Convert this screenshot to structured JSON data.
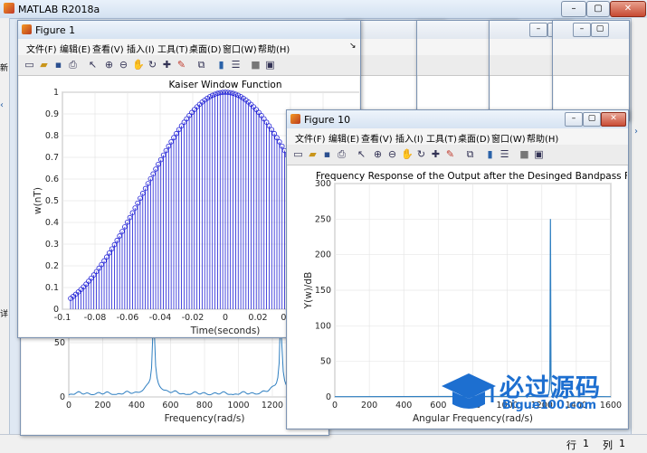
{
  "main": {
    "title": "MATLAB R2018a",
    "left_labels": {
      "new": "新",
      "detail": "详"
    },
    "status": {
      "row_label": "行",
      "row_value": "1",
      "col_label": "列",
      "col_value": "1"
    }
  },
  "figure_menu": [
    "文件(F)",
    "编辑(E)",
    "查看(V)",
    "插入(I)",
    "工具(T)",
    "桌面(D)",
    "窗口(W)",
    "帮助(H)"
  ],
  "figure1": {
    "title": "Figure 1",
    "chart_data": {
      "type": "stem",
      "title": "Kaiser Window Function",
      "xlabel": "Time(seconds)",
      "ylabel": "w(nT)",
      "xlim": [
        -0.1,
        0.1
      ],
      "ylim": [
        0,
        1
      ],
      "xticks": [
        "-0.1",
        "-0.08",
        "-0.06",
        "-0.04",
        "-0.02",
        "0",
        "0.02",
        "0.04",
        "0.06"
      ],
      "yticks": [
        "0",
        "0.1",
        "0.2",
        "0.3",
        "0.4",
        "0.5",
        "0.6",
        "0.7",
        "0.8",
        "0.9",
        "1"
      ],
      "x_range": [
        -0.095,
        0.095
      ],
      "point_count": 121,
      "y_min": 0.05,
      "y_max": 1.0,
      "color": "#1f1fd6"
    }
  },
  "figure10": {
    "title": "Figure 10",
    "chart_data": {
      "type": "line",
      "title": "Frequency Response of the Output after the  Desinged Bandpass Filter",
      "xlabel": "Angular Frequency(rad/s)",
      "ylabel": "Y(w)/dB",
      "xlim": [
        0,
        1600
      ],
      "ylim": [
        0,
        300
      ],
      "xticks": [
        "0",
        "200",
        "400",
        "600",
        "800",
        "1000",
        "1200",
        "1400",
        "1600"
      ],
      "yticks": [
        "0",
        "50",
        "100",
        "150",
        "200",
        "250",
        "300"
      ],
      "peaks": [
        {
          "x": 1250,
          "y": 250
        }
      ],
      "color": "#2f7fc1"
    }
  },
  "figure_bg": {
    "chart_data": {
      "type": "line",
      "xlabel": "Frequency(rad/s)",
      "xlim": [
        0,
        1600
      ],
      "xticks": [
        "0",
        "200",
        "400",
        "600",
        "800",
        "1000",
        "1200",
        "1400"
      ],
      "yticks": [
        "0",
        "50"
      ],
      "peaks": [
        {
          "x": 500,
          "y": 80
        },
        {
          "x": 1250,
          "y": 80
        }
      ],
      "color": "#2f7fc1"
    }
  },
  "watermark": {
    "text": "必过源码",
    "url": "Bigue100.com"
  }
}
